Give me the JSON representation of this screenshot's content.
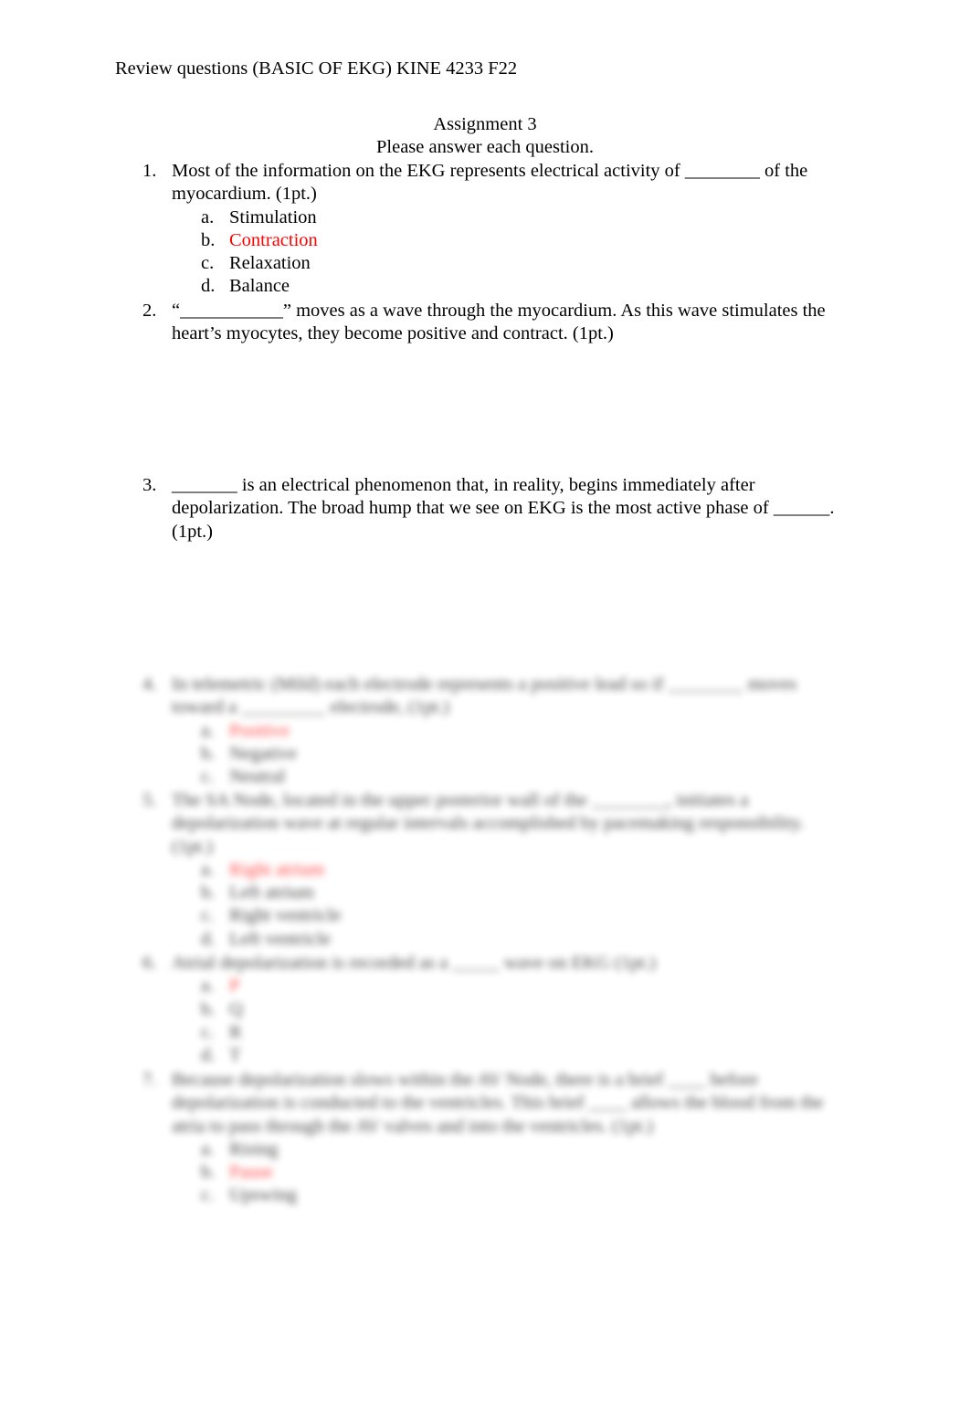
{
  "document": {
    "header": "Review questions (BASIC OF EKG) KINE 4233 F22",
    "title": "Assignment 3",
    "instructions": "Please answer each question.",
    "highlight_color": "#ff0000"
  },
  "questions": [
    {
      "number": "1.",
      "text": "Most of the information on the EKG represents electrical activity of ________ of the myocardium. (1pt.)",
      "options": [
        {
          "letter": "a.",
          "text": "Stimulation",
          "selected": false
        },
        {
          "letter": "b.",
          "text": "Contraction",
          "selected": true
        },
        {
          "letter": "c.",
          "text": "Relaxation",
          "selected": false
        },
        {
          "letter": "d.",
          "text": "Balance",
          "selected": false
        }
      ]
    },
    {
      "number": "2.",
      "text": "“___________” moves as a wave through the myocardium. As this wave stimulates the heart’s myocytes, they become positive and contract.   (1pt.)"
    },
    {
      "number": "3.",
      "text": "_______ is an electrical phenomenon that, in reality, begins immediately after depolarization. The broad hump that we see on EKG is the most active phase of ______. (1pt.)"
    }
  ],
  "blurred_preview": {
    "note": "remaining content blurred in preview",
    "questions": [
      {
        "number": "4.",
        "text": "In telemetric (Mild) each electrode represents a positive lead so if ________ moves toward a _________ electrode, (1pt.)",
        "options": [
          {
            "letter": "a.",
            "text": "Positive",
            "selected": true
          },
          {
            "letter": "b.",
            "text": "Negative",
            "selected": false
          },
          {
            "letter": "c.",
            "text": "Neutral",
            "selected": false
          }
        ]
      },
      {
        "number": "5.",
        "text": "The SA Node, located in the upper posterior wall of the ________, initiates a depolarization wave at regular intervals accomplished by pacemaking responsibility. (1pt.)",
        "options": [
          {
            "letter": "a.",
            "text": "Right atrium",
            "selected": true
          },
          {
            "letter": "b.",
            "text": "Left atrium",
            "selected": false
          },
          {
            "letter": "c.",
            "text": "Right ventricle",
            "selected": false
          },
          {
            "letter": "d.",
            "text": "Left ventricle",
            "selected": false
          }
        ]
      },
      {
        "number": "6.",
        "text": "Atrial depolarization is recorded as a _____ wave on EKG (1pt.)",
        "options": [
          {
            "letter": "a.",
            "text": "P",
            "selected": true
          },
          {
            "letter": "b.",
            "text": "Q",
            "selected": false
          },
          {
            "letter": "c.",
            "text": "R",
            "selected": false
          },
          {
            "letter": "d.",
            "text": "T",
            "selected": false
          }
        ]
      },
      {
        "number": "7.",
        "text": "Because depolarization slows within the AV Node, there is a brief ____ before depolarization is conducted to the ventricles. This brief ____ allows the blood from the atria to pass through the AV valves and into the ventricles. (1pt.)",
        "options": [
          {
            "letter": "a.",
            "text": "Rising",
            "selected": false
          },
          {
            "letter": "b.",
            "text": "Pause",
            "selected": true
          },
          {
            "letter": "c.",
            "text": "Upswing",
            "selected": false
          }
        ]
      }
    ]
  }
}
